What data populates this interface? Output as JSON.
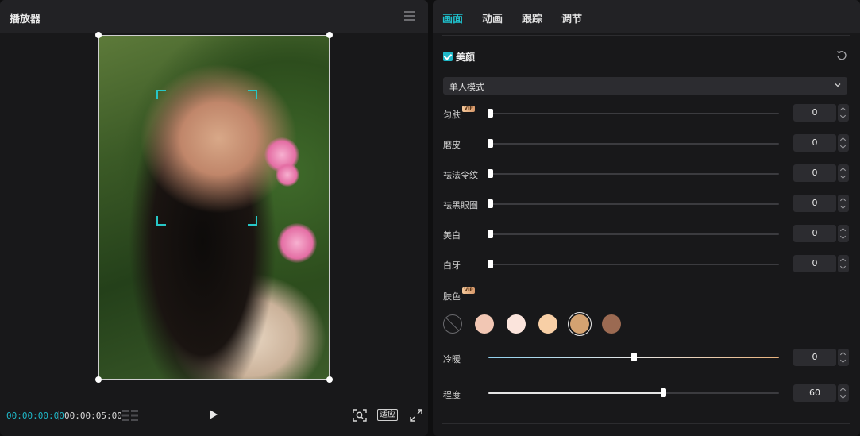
{
  "player": {
    "title": "播放器",
    "current_time": "00:00:00:00",
    "total_time": "00:00:05:00",
    "fit_label": "适应"
  },
  "inspector": {
    "tabs": [
      {
        "label": "画面",
        "active": true
      },
      {
        "label": "动画",
        "active": false
      },
      {
        "label": "跟踪",
        "active": false
      },
      {
        "label": "调节",
        "active": false
      }
    ],
    "section_title": "美颜",
    "section_checked": true,
    "mode_select": {
      "value": "单人模式"
    },
    "sliders": [
      {
        "label": "匀肤",
        "vip": true,
        "value": "0",
        "level": 0
      },
      {
        "label": "磨皮",
        "vip": false,
        "value": "0",
        "level": 0
      },
      {
        "label": "祛法令纹",
        "vip": false,
        "value": "0",
        "level": 0
      },
      {
        "label": "祛黑眼圈",
        "vip": false,
        "value": "0",
        "level": 0
      },
      {
        "label": "美白",
        "vip": false,
        "value": "0",
        "level": 0
      },
      {
        "label": "白牙",
        "vip": false,
        "value": "0",
        "level": 0
      }
    ],
    "skin_tone": {
      "label": "肤色",
      "vip": true,
      "swatches": [
        "none",
        "#f2c7b4",
        "#fbe4dc",
        "#f8cfa6",
        "#d4a271",
        "#9b6a52"
      ],
      "selected_index": 4
    },
    "warmth": {
      "label": "冷暖",
      "value": "0",
      "level": 0.5
    },
    "intensity": {
      "label": "程度",
      "value": "60",
      "level": 0.6
    },
    "vip_badge_text": "VIP",
    "accent_color": "#1fc3cf"
  }
}
